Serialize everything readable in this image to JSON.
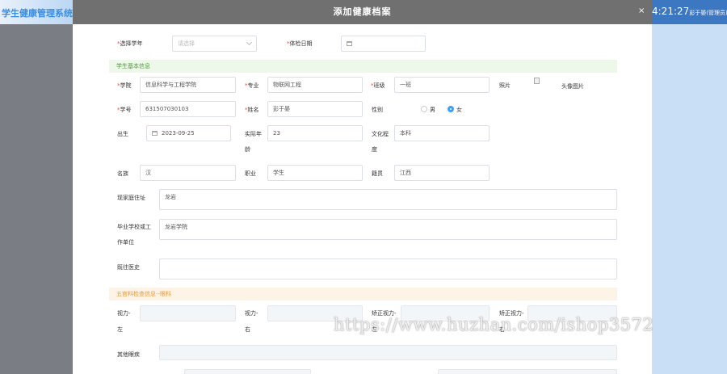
{
  "app": {
    "title": "学生健康管理系统",
    "clock": "4:21:27",
    "user": "彭于晏(管理员)"
  },
  "modal": {
    "title": "添加健康档案",
    "close": "×"
  },
  "top": {
    "year_label": "选择学年",
    "year_placeholder": "请选择",
    "date_label": "体检日期"
  },
  "section1": "学生基本信息",
  "fields": {
    "college_label": "学院",
    "college": "信息科学与工程学院",
    "major_label": "专业",
    "major": "物联网工程",
    "class_label": "班级",
    "class": "一班",
    "photo_label": "照片",
    "photo_alt": "头像图片",
    "id_label": "学号",
    "id": "631507030103",
    "name_label": "姓名",
    "name": "彭于晏",
    "gender_label": "性别",
    "gender_m": "男",
    "gender_f": "女",
    "birth_label": "出生",
    "birth": "2023-09-25",
    "age_label_1": "实际年",
    "age_label_2": "龄",
    "age": "23",
    "edu_label_1": "文化程",
    "edu_label_2": "度",
    "edu": "本科",
    "ethnic_label": "名族",
    "ethnic": "汉",
    "job_label": "职业",
    "job": "学生",
    "origin_label": "籍贯",
    "origin": "江西",
    "address_label": "现家庭住址",
    "address": "龙岩",
    "school_label_1": "毕业学校或工",
    "school_label_2": "作单位",
    "school": "龙岩学院",
    "history_label": "既往医史"
  },
  "section2": "五官科检查信息--眼科",
  "eye": {
    "left_label_1": "视力-",
    "left_label_2": "左",
    "right_label_1": "视力-",
    "right_label_2": "右",
    "cleft_label_1": "矫正视力-",
    "cleft_label_2": "左",
    "cright_label_1": "矫正视力-",
    "cright_label_2": "右",
    "other_label": "其他眼疾"
  },
  "watermark": "https://www.huzhan.com/ishop3572",
  "colors": {
    "accent": "#409eff",
    "header": "#707070",
    "required": "#e44444"
  }
}
